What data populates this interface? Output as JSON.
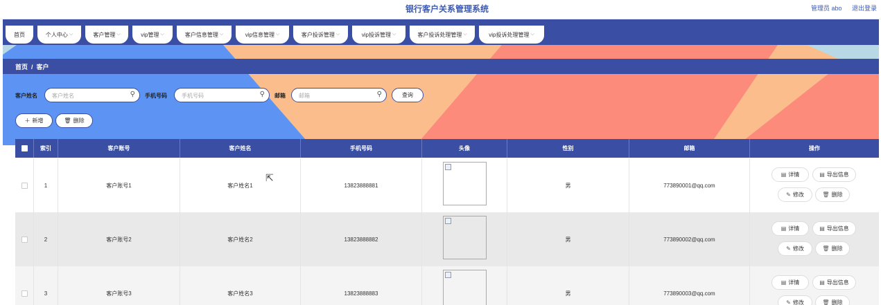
{
  "app": {
    "title": "银行客户关系管理系统",
    "admin_label": "管理员 abo",
    "logout_label": "退出登录"
  },
  "nav": {
    "items": [
      {
        "label": "首页"
      },
      {
        "label": "个人中心"
      },
      {
        "label": "客户管理"
      },
      {
        "label": "vip管理"
      },
      {
        "label": "客户信息管理"
      },
      {
        "label": "vip信息管理"
      },
      {
        "label": "客户投诉管理"
      },
      {
        "label": "vip投诉管理"
      },
      {
        "label": "客户投诉处理管理"
      },
      {
        "label": "vip投诉处理管理"
      }
    ]
  },
  "breadcrumb": {
    "home": "首页",
    "separator": "/",
    "current": "客户"
  },
  "search": {
    "name_label": "客户姓名",
    "name_placeholder": "客户姓名",
    "phone_label": "手机号码",
    "phone_placeholder": "手机号码",
    "email_label": "邮箱",
    "email_placeholder": "邮箱",
    "query_label": "查询"
  },
  "actions": {
    "add_label": "新增",
    "delete_label": "删除"
  },
  "table": {
    "headers": [
      "索引",
      "客户账号",
      "客户姓名",
      "手机号码",
      "头像",
      "性别",
      "邮箱",
      "操作"
    ],
    "rows": [
      {
        "index": "1",
        "account": "客户账号1",
        "name": "客户姓名1",
        "phone": "13823888881",
        "gender": "男",
        "email": "773890001@qq.com"
      },
      {
        "index": "2",
        "account": "客户账号2",
        "name": "客户姓名2",
        "phone": "13823888882",
        "gender": "男",
        "email": "773890002@qq.com"
      },
      {
        "index": "3",
        "account": "客户账号3",
        "name": "客户姓名3",
        "phone": "13823888883",
        "gender": "男",
        "email": "773890003@qq.com"
      }
    ],
    "row_actions": {
      "detail": "详情",
      "export": "导出信息",
      "edit": "修改",
      "delete": "删除"
    }
  },
  "colors": {
    "primary": "#3a4fa3",
    "bg_blue": "#5d94f3",
    "bg_peach": "#fbbd8c",
    "bg_salmon": "#fd8b7c",
    "bg_lightblue": "#b8d8e6"
  }
}
